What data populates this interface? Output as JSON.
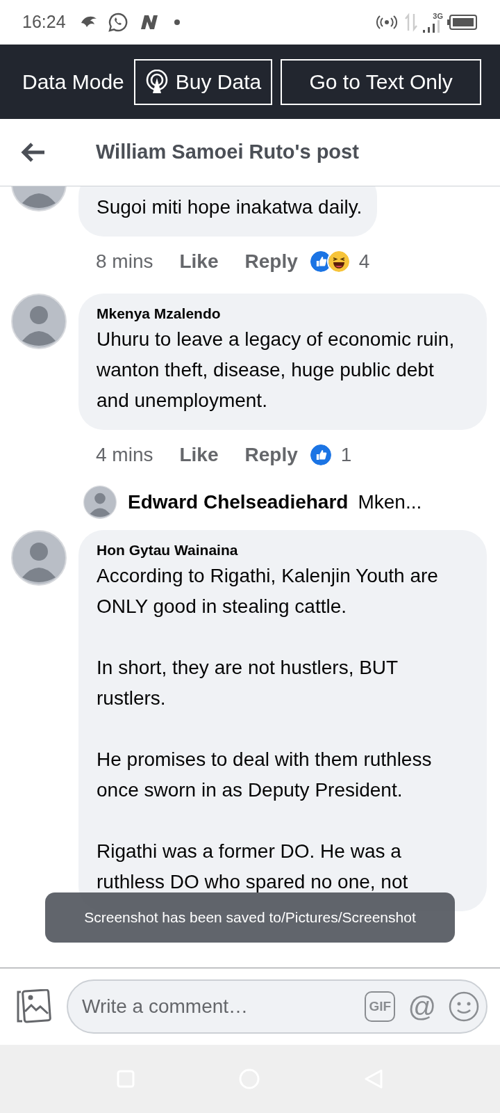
{
  "status_bar": {
    "time": "16:24",
    "network": "3G"
  },
  "data_bar": {
    "label": "Data Mode",
    "buttons": [
      {
        "kind": "buy",
        "label": "Buy Data"
      },
      {
        "kind": "text",
        "label": "Go to Text Only"
      }
    ]
  },
  "header": {
    "title": "William Samoei Ruto's post"
  },
  "comments": [
    {
      "paragraphs": [
        "Sugoi miti hope inakatwa daily."
      ],
      "time": "8 mins",
      "actions": [
        "Like",
        "Reply"
      ],
      "reactions": [
        {
          "kind": "like"
        },
        {
          "kind": "haha"
        }
      ],
      "reaction_count": "4"
    },
    {
      "author": "Mkenya Mzalendo",
      "paragraphs": [
        "Uhuru to leave a legacy of economic ruin, wanton theft, disease, huge public debt and unemployment."
      ],
      "time": "4 mins",
      "actions": [
        "Like",
        "Reply"
      ],
      "reactions": [
        {
          "kind": "like"
        }
      ],
      "reaction_count": "1",
      "reply_preview": {
        "author": "Edward Chelseadiehard",
        "text": "Mken..."
      }
    },
    {
      "author": "Hon Gytau Wainaina",
      "paragraphs": [
        "According to Rigathi, Kalenjin Youth are ONLY good in stealing cattle.",
        "In short, they are not hustlers, BUT rustlers.",
        "He promises to deal with them ruthless once sworn in as Deputy President.",
        "Rigathi was a former DO. He was a ruthless DO who spared no one, not"
      ]
    }
  ],
  "toast": {
    "text": "Screenshot has been saved to/Pictures/Screenshot"
  },
  "composer": {
    "placeholder": "Write a comment…",
    "gif": "GIF",
    "mention": "@"
  }
}
